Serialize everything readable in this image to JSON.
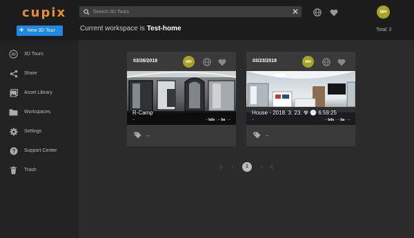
{
  "app": {
    "logo": "cupix"
  },
  "header": {
    "new_tour_label": "New 3D Tour",
    "search_placeholder": "Search 3D Tours",
    "user_initials": "MH",
    "workspace_prefix": "Current workspace is ",
    "workspace_name": "Test-home",
    "total": "Total: 2"
  },
  "sidebar": {
    "items": [
      {
        "label": "3D Tours",
        "icon": "360-icon"
      },
      {
        "label": "Share",
        "icon": "share-icon"
      },
      {
        "label": "Asset Library",
        "icon": "image-library-icon"
      },
      {
        "label": "Workspaces",
        "icon": "folder-icon"
      },
      {
        "label": "Settings",
        "icon": "gear-icon"
      },
      {
        "label": "Support Center",
        "icon": "help-icon"
      },
      {
        "label": "Trash",
        "icon": "trash-icon"
      }
    ]
  },
  "tours": [
    {
      "date": "03/26/2018",
      "owner_initials": "MH",
      "title": "R-Camp",
      "subtitle": "--",
      "meta": {
        "bds_value": "--",
        "bds_label": "bds",
        "ba_value": "--",
        "ba_label": "ba",
        "trail": "--"
      },
      "tags": "--"
    },
    {
      "date": "03/23/2018",
      "owner_initials": "MH",
      "title": "House - 2018. 3. 23. ☢ 🕑 6:59:25",
      "subtitle": "--",
      "meta": {
        "bds_value": "--",
        "bds_label": "bds",
        "ba_value": "--",
        "ba_label": "ba",
        "trail": "--"
      },
      "tags": "--"
    }
  ],
  "pagination": {
    "first": "|‹",
    "prev": "‹",
    "current": "1",
    "next": "›",
    "last": "›|"
  },
  "colors": {
    "accent": "#e8902a",
    "primary_button": "#1e88e5",
    "avatar": "#a8a324"
  }
}
